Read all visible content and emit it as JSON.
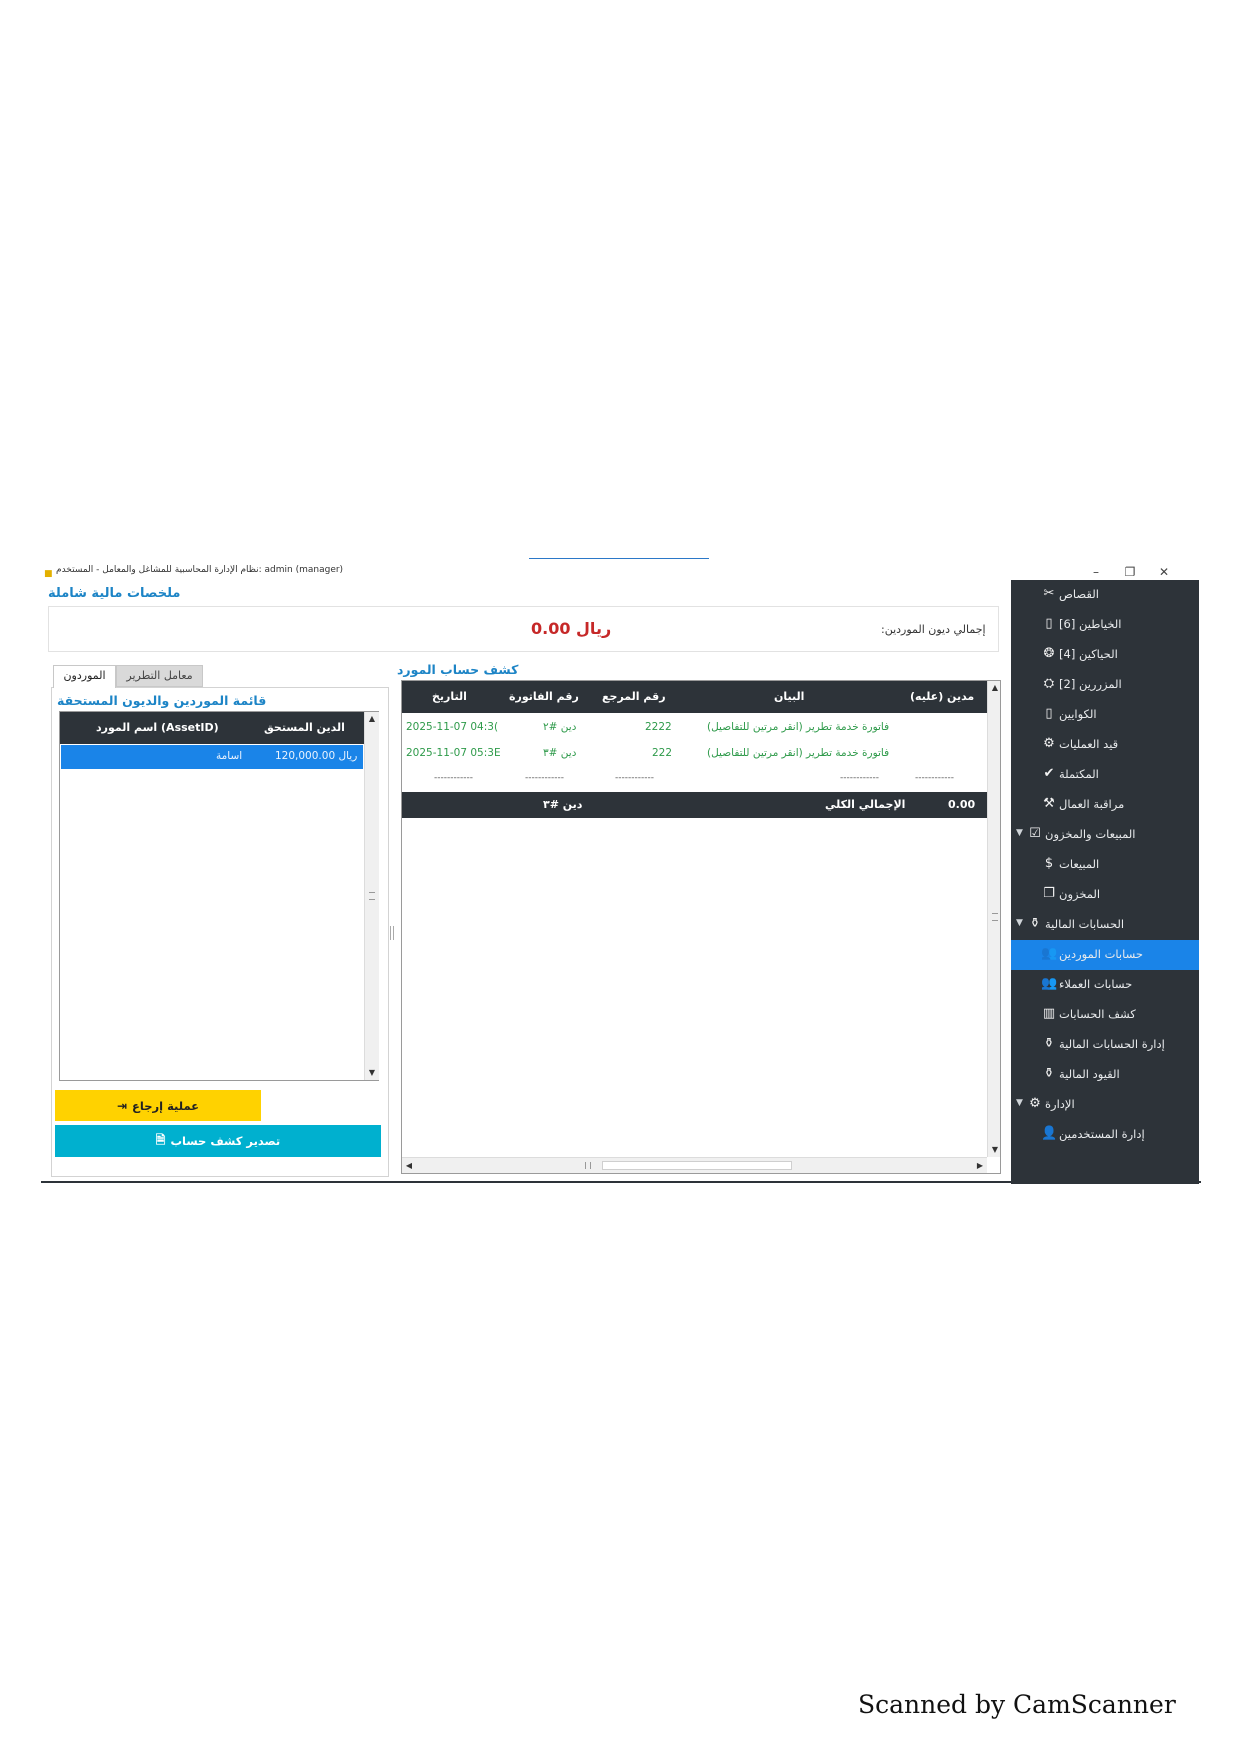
{
  "window": {
    "title": "نظام الإدارة المحاسبية للمشاغل والمعامل - المستخدم: admin (manager)",
    "controls": {
      "minimize": "–",
      "restore": "❐",
      "close": "✕"
    }
  },
  "sidebar": {
    "items": [
      {
        "label": "القصاص",
        "icon": "scissors-icon",
        "glyph": "✂"
      },
      {
        "label": "الخياطين [6]",
        "icon": "box-icon",
        "glyph": "▯"
      },
      {
        "label": "الحياكين [4]",
        "icon": "yarn-icon",
        "glyph": "❂"
      },
      {
        "label": "المزررين [2]",
        "icon": "sewing-machine-icon",
        "glyph": "⛭"
      },
      {
        "label": "الكوايين",
        "icon": "box-icon",
        "glyph": "▯"
      },
      {
        "label": "قيد العمليات",
        "icon": "cog-icon",
        "glyph": "⚙"
      },
      {
        "label": "المكتملة",
        "icon": "check-icon",
        "glyph": "✔"
      },
      {
        "label": "مراقبة العمال",
        "icon": "worker-icon",
        "glyph": "⚒"
      },
      {
        "label": "المبيعات والمخزون",
        "icon": "checkbox-icon",
        "glyph": "☑",
        "expandable": true,
        "arrow": "▼"
      },
      {
        "label": "المبيعات",
        "icon": "money-icon",
        "glyph": "$"
      },
      {
        "label": "المخزون",
        "icon": "inventory-icon",
        "glyph": "❐"
      },
      {
        "label": "الحسابات المالية",
        "icon": "money-bag-icon",
        "glyph": "⚱",
        "expandable": true,
        "arrow": "▼"
      },
      {
        "label": "حسابات الموردين",
        "icon": "users-icon",
        "glyph": "👥",
        "active": true
      },
      {
        "label": "حسابات العملاء",
        "icon": "users-icon",
        "glyph": "👥"
      },
      {
        "label": "كشف الحسابات",
        "icon": "bar-chart-icon",
        "glyph": "▥"
      },
      {
        "label": "إدارة الحسابات المالية",
        "icon": "money-bag-icon",
        "glyph": "⚱"
      },
      {
        "label": "القيود المالية",
        "icon": "money-bag-icon",
        "glyph": "⚱"
      },
      {
        "label": "الإدارة",
        "icon": "settings-icon",
        "glyph": "⚙",
        "expandable": true,
        "arrow": "▼"
      },
      {
        "label": "إدارة المستخدمين",
        "icon": "user-icon",
        "glyph": "👤"
      }
    ]
  },
  "summary": {
    "title": "ملخصات مالية شاملة",
    "total_label": "إجمالي ديون الموردين:",
    "total_value": "0.00 ريال"
  },
  "tabs": [
    {
      "label": "الموردون",
      "active": true
    },
    {
      "label": "معامل التطرير",
      "active": false
    }
  ],
  "suppliers": {
    "title": "قائمة الموردين والديون المستحقة",
    "columns": {
      "name": "اسم المورد (AssetID)",
      "debt": "الدين المستحق"
    },
    "rows": [
      {
        "name": "اسامة",
        "debt": "120,000.00 ريال"
      }
    ],
    "scroll_up": "▲",
    "scroll_down": "▼"
  },
  "buttons": {
    "return": {
      "label": "عملية إرجاع",
      "glyph": "⇥"
    },
    "export": {
      "label": "تصدير كشف حساب",
      "glyph": "🗎"
    }
  },
  "statement": {
    "title": "كشف حساب المورد",
    "columns": {
      "date": "التاريخ",
      "invoice": "رقم الفاتورة",
      "ref": "رقم المرجع",
      "desc": "البيان",
      "debit": "مدين (عليه)"
    },
    "rows": [
      {
        "date": "2025-11-07 04:3(",
        "invoice": "دين #٢",
        "ref": "2222",
        "desc": "فاتورة خدمة تطرير (انقر مرتين للتفاصيل)"
      },
      {
        "date": "2025-11-07 05:3E",
        "invoice": "دين #٣",
        "ref": "222",
        "desc": "فاتورة خدمة تطرير (انقر مرتين للتفاصيل)"
      }
    ],
    "separator": "------------",
    "total": {
      "invoice": "دين #٣",
      "label": "الإجمالي الكلي",
      "value": "0.00"
    },
    "scroll_up": "▲",
    "scroll_down": "▼",
    "scroll_left": "◀",
    "scroll_right": "▶"
  },
  "footer": {
    "text": "Scanned by CamScanner"
  }
}
